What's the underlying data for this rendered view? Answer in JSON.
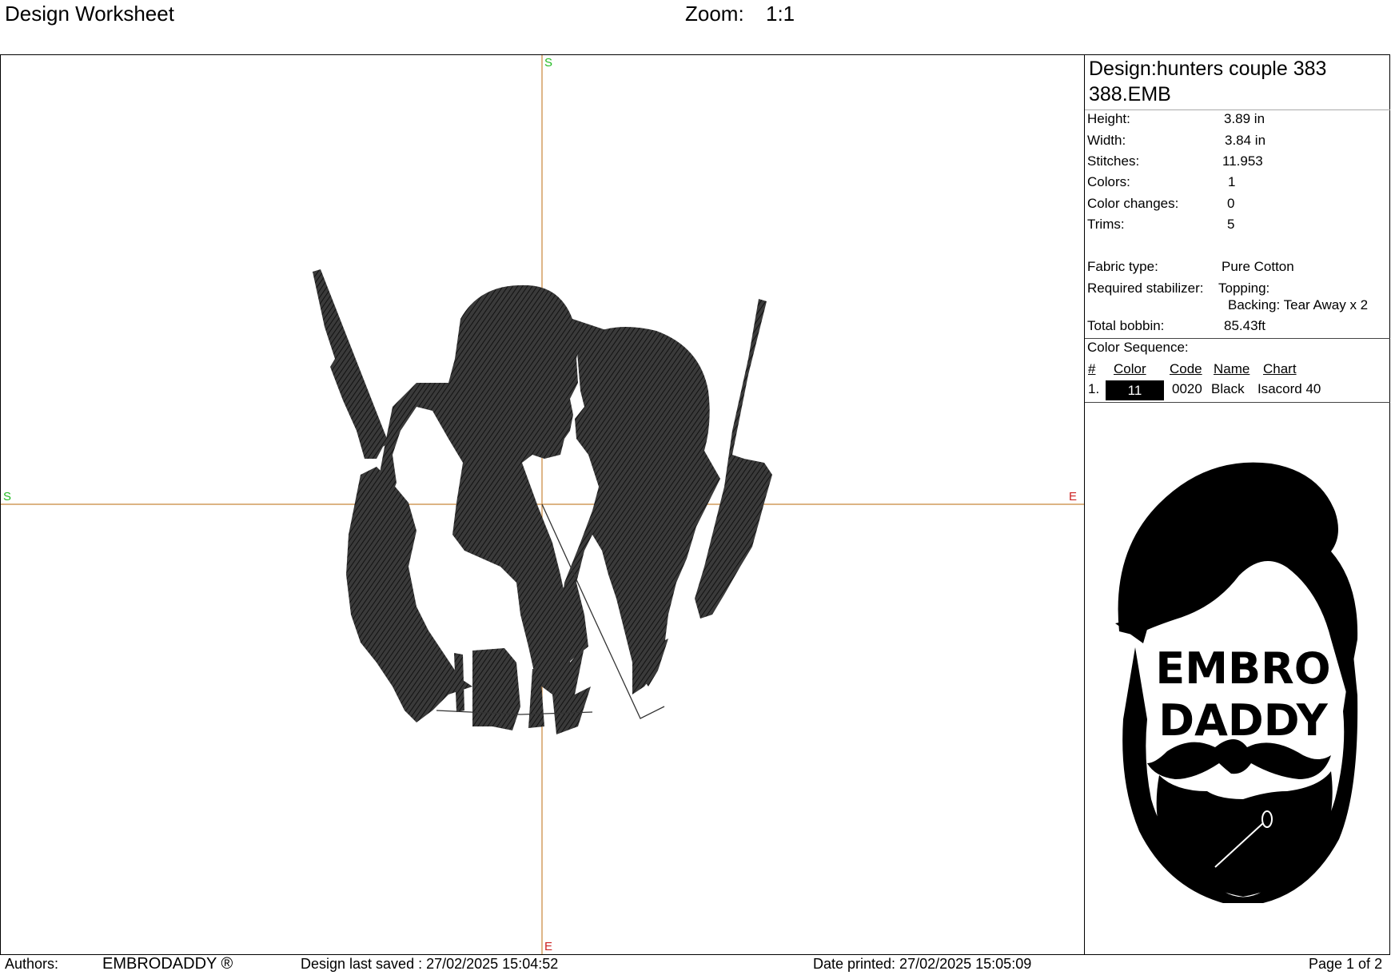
{
  "header": {
    "title": "Design Worksheet",
    "zoom_label": "Zoom:",
    "zoom_value": "1:1"
  },
  "canvas": {
    "axis_top": "S",
    "axis_left": "S",
    "axis_right": "E",
    "axis_bottom": "E"
  },
  "design": {
    "title": "Design:hunters couple 383 388.EMB",
    "stats": [
      {
        "label": "Height:",
        "value": "3.89 in"
      },
      {
        "label": "Width:",
        "value": "3.84 in"
      },
      {
        "label": "Stitches:",
        "value": "11.953"
      },
      {
        "label": "Colors:",
        "value": "1"
      },
      {
        "label": "Color changes:",
        "value": "0"
      },
      {
        "label": "Trims:",
        "value": "5"
      }
    ],
    "fabric_label": "Fabric type:",
    "fabric_value": "Pure Cotton",
    "stabilizer_label": "Required stabilizer:",
    "stabilizer_topping": "Topping:",
    "stabilizer_backing": "Backing: Tear Away x 2",
    "bobbin_label": "Total bobbin:",
    "bobbin_value": "85.43ft"
  },
  "color_sequence": {
    "title": "Color Sequence:",
    "headers": [
      "#",
      "Color",
      "Code",
      "Name",
      "Chart"
    ],
    "rows": [
      {
        "num": "1.",
        "color": "11",
        "code": "0020",
        "name": "Black",
        "chart": "Isacord 40",
        "swatch": "#000000"
      }
    ]
  },
  "logo": {
    "line1": "EMBRO",
    "line2": "DADDY"
  },
  "footer": {
    "authors_label": "Authors:",
    "authors_value": "EMBRODADDY ®",
    "saved": "Design last saved : 27/02/2025 15:04:52",
    "printed": "Date printed: 27/02/2025 15:05:09",
    "page": "Page 1 of 2"
  }
}
